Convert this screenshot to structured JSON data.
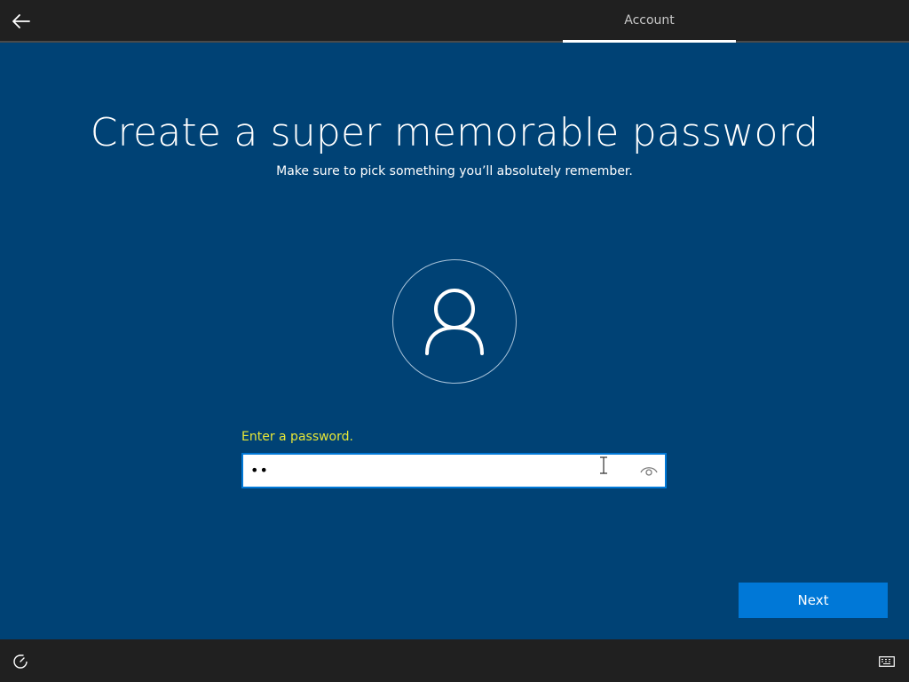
{
  "header": {
    "back_icon": "arrow-left-icon",
    "tab_label": "Account"
  },
  "main": {
    "title": "Create a super memorable password",
    "subtitle": "Make sure to pick something you’ll absolutely remember.",
    "avatar_icon": "user-icon",
    "password_label": "Enter a password.",
    "password_value": "••",
    "reveal_icon": "eye-icon",
    "next_label": "Next"
  },
  "footer": {
    "ease_of_access_icon": "ease-of-access-icon",
    "keyboard_icon": "keyboard-icon"
  },
  "colors": {
    "background": "#004275",
    "bar": "#202020",
    "accent": "#0078d7",
    "label_highlight": "#e6e636"
  }
}
